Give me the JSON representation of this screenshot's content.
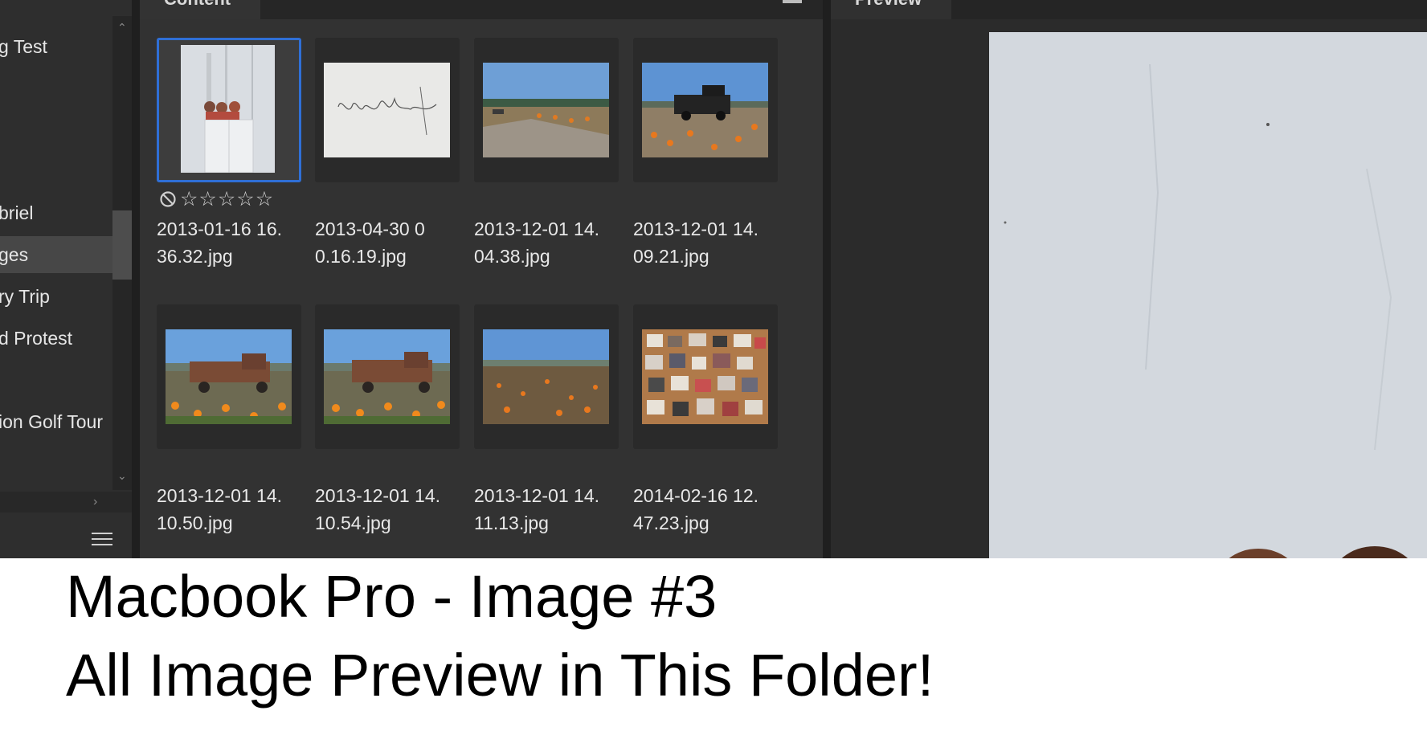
{
  "folders": {
    "items": [
      {
        "label": "g Test"
      },
      {
        "label": "briel"
      },
      {
        "label": "ges"
      },
      {
        "label": "ry Trip"
      },
      {
        "label": "d Protest"
      },
      {
        "label": "ion Golf Tour"
      }
    ],
    "selected_index": 2
  },
  "content": {
    "tab_label": "Content",
    "selected_rating": {
      "rejected": false,
      "stars": 0,
      "max_stars": 5
    },
    "thumbnails": [
      {
        "filename_line1": "2013-01-16 16.",
        "filename_line2": "36.32.jpg",
        "subject": "three-heads-white-wall",
        "selected": true
      },
      {
        "filename_line1": "2013-04-30 0",
        "filename_line2": "0.16.19.jpg",
        "subject": "signature",
        "selected": false
      },
      {
        "filename_line1": "2013-12-01 14.",
        "filename_line2": "04.38.jpg",
        "subject": "pumpkin-field-road",
        "selected": false
      },
      {
        "filename_line1": "2013-12-01 14.",
        "filename_line2": "09.21.jpg",
        "subject": "black-truck-pumpkins",
        "selected": false
      },
      {
        "filename_line1": "2013-12-01 14.",
        "filename_line2": "10.50.jpg",
        "subject": "rusty-truck-pumpkins",
        "selected": false
      },
      {
        "filename_line1": "2013-12-01 14.",
        "filename_line2": "10.54.jpg",
        "subject": "rusty-truck-pumpkins",
        "selected": false
      },
      {
        "filename_line1": "2013-12-01 14.",
        "filename_line2": "11.13.jpg",
        "subject": "pumpkin-field",
        "selected": false
      },
      {
        "filename_line1": "2014-02-16 12.",
        "filename_line2": "47.23.jpg",
        "subject": "photo-collage-table",
        "selected": false
      }
    ]
  },
  "preview": {
    "tab_label": "Preview"
  },
  "caption": {
    "line1": "Macbook Pro - Image #3",
    "line2": "All Image Preview in This Folder!"
  },
  "colors": {
    "selection_border": "#2f6fd6",
    "panel_bg": "#323232",
    "text": "#e8e8e8"
  },
  "icons": {
    "reject": "reject-icon",
    "star": "star-outline-icon",
    "panel_menu": "hamburger-menu-icon"
  }
}
